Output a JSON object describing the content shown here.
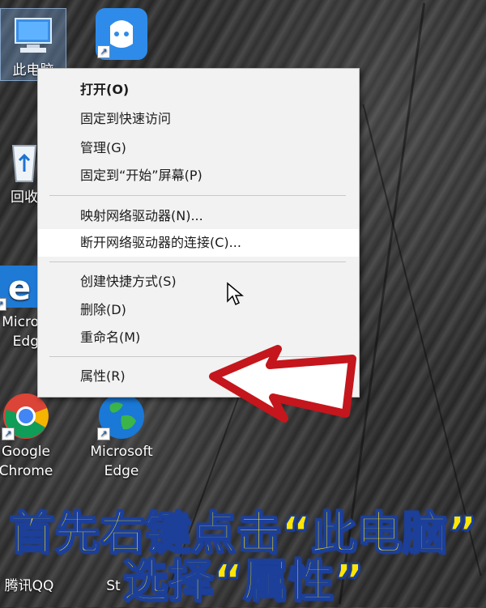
{
  "desktop": {
    "icons": [
      {
        "label": "此电脑",
        "icon": "computer-icon"
      },
      {
        "label": "",
        "icon": "app-icon"
      },
      {
        "label": "回收",
        "icon": "recycle-bin-icon"
      },
      {
        "label": "Micro\nEdg",
        "icon": "edge-icon"
      },
      {
        "label": "Google\nChrome",
        "icon": "chrome-icon"
      },
      {
        "label": "Microsoft\nEdge",
        "icon": "globe-icon"
      },
      {
        "label": "腾讯QQ",
        "icon": "qq-icon"
      },
      {
        "label": "St",
        "icon": "app-icon"
      }
    ]
  },
  "context_menu": {
    "items": [
      {
        "label": "打开(O)"
      },
      {
        "label": "固定到快速访问"
      },
      {
        "label": "管理(G)"
      },
      {
        "label": "固定到“开始”屏幕(P)"
      },
      {
        "label": "映射网络驱动器(N)..."
      },
      {
        "label": "断开网络驱动器的连接(C)..."
      },
      {
        "label": "创建快捷方式(S)"
      },
      {
        "label": "删除(D)"
      },
      {
        "label": "重命名(M)"
      },
      {
        "label": "属性(R)"
      }
    ]
  },
  "caption": {
    "line1": "首先右键点击“此电脑”",
    "line2": "选择“属性”"
  },
  "colors": {
    "caption_fill": "#ffe600",
    "caption_stroke": "#1c3f9a",
    "arrow": "#c4161c"
  }
}
